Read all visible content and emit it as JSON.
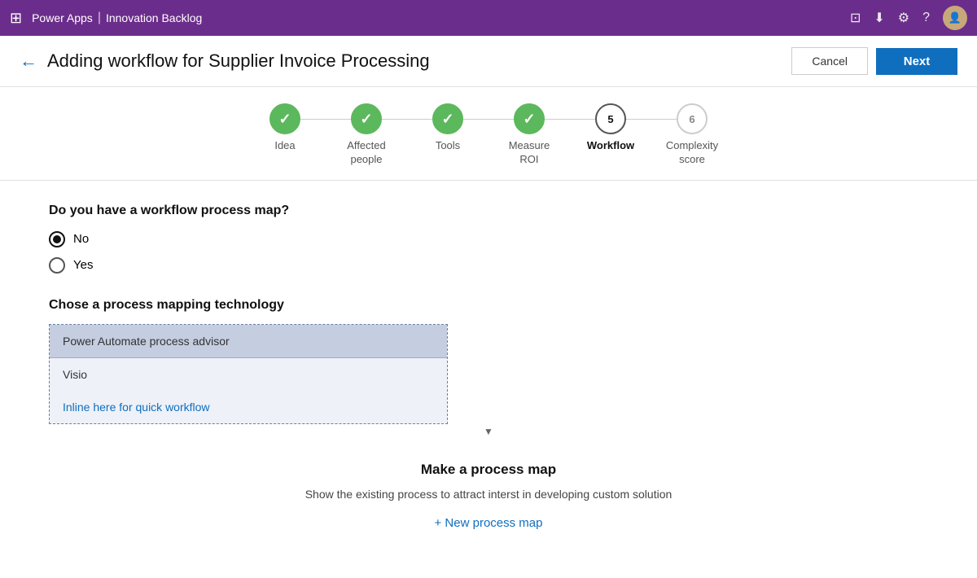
{
  "topbar": {
    "app_name": "Power Apps",
    "separator": "|",
    "section": "Innovation Backlog",
    "icons": [
      "monitor-icon",
      "download-icon",
      "settings-icon",
      "help-icon"
    ]
  },
  "header": {
    "title": "Adding workflow for Supplier Invoice Processing",
    "cancel_label": "Cancel",
    "next_label": "Next"
  },
  "stepper": {
    "steps": [
      {
        "id": 1,
        "label": "Idea",
        "state": "completed",
        "display": "✓"
      },
      {
        "id": 2,
        "label": "Affected\npeople",
        "state": "completed",
        "display": "✓"
      },
      {
        "id": 3,
        "label": "Tools",
        "state": "completed",
        "display": "✓"
      },
      {
        "id": 4,
        "label": "Measure\nROI",
        "state": "completed",
        "display": "✓"
      },
      {
        "id": 5,
        "label": "Workflow",
        "state": "active",
        "display": "5"
      },
      {
        "id": 6,
        "label": "Complexity\nscore",
        "state": "inactive",
        "display": "6"
      }
    ]
  },
  "workflow_question": {
    "label": "Do you have a workflow process map?",
    "options": [
      {
        "id": "no",
        "label": "No",
        "selected": true
      },
      {
        "id": "yes",
        "label": "Yes",
        "selected": false
      }
    ]
  },
  "process_mapping": {
    "section_label": "Chose a process mapping technology",
    "dropdown_selected": "Power Automate process advisor",
    "dropdown_items": [
      {
        "id": "visio",
        "label": "Visio",
        "style": "normal"
      },
      {
        "id": "inline",
        "label": "Inline here for quick workflow",
        "style": "link"
      }
    ],
    "dropdown_arrow": "▼"
  },
  "process_map_section": {
    "title": "Make a process map",
    "description": "Show the existing process to attract interst in\ndeveloping custom solution",
    "new_link": "+ New process map"
  }
}
